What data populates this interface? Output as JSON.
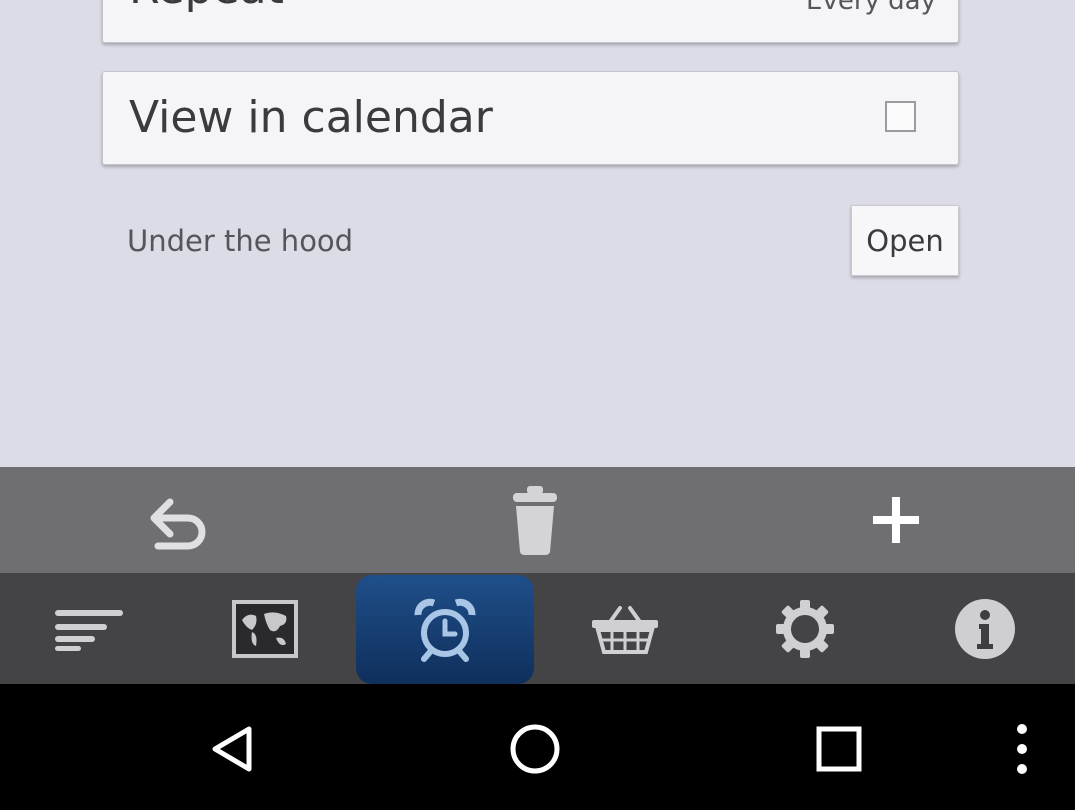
{
  "settings": {
    "repeat": {
      "label": "Repeat",
      "value": "Every day"
    },
    "view_in_calendar": {
      "label": "View in calendar",
      "checked": false
    },
    "under_the_hood": {
      "label": "Under the hood",
      "button": "Open"
    }
  },
  "action_bar": {
    "items": [
      {
        "icon": "undo-icon"
      },
      {
        "icon": "trash-icon"
      },
      {
        "icon": "plus-icon"
      }
    ]
  },
  "tabs": {
    "active_index": 2,
    "items": [
      {
        "icon": "menu-lines-icon"
      },
      {
        "icon": "world-map-icon"
      },
      {
        "icon": "alarm-clock-icon"
      },
      {
        "icon": "basket-icon"
      },
      {
        "icon": "gear-icon"
      },
      {
        "icon": "info-icon"
      }
    ]
  },
  "nav_bar": {
    "items": [
      {
        "icon": "back-triangle-icon"
      },
      {
        "icon": "home-circle-icon"
      },
      {
        "icon": "recents-square-icon"
      },
      {
        "icon": "overflow-dots-icon"
      }
    ]
  },
  "colors": {
    "background": "#dcdce6",
    "action_bar": "#6e6e73",
    "tab_bar": "#444447",
    "active_tab": "#1f4f8a",
    "nav_bar": "#000000"
  }
}
